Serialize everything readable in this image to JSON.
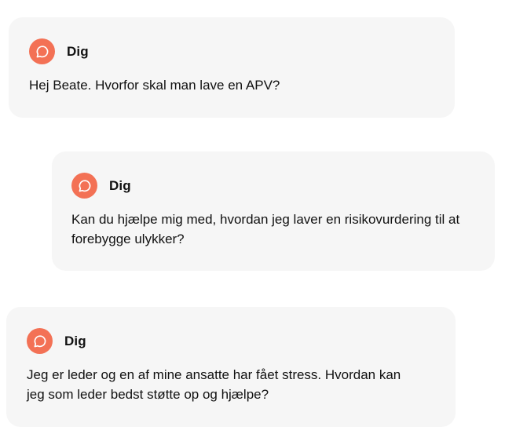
{
  "messages": [
    {
      "sender": "Dig",
      "text": "Hej Beate. Hvorfor skal man lave en APV?",
      "avatar_icon": "chat-bubble-icon"
    },
    {
      "sender": "Dig",
      "text": "Kan du hjælpe mig med, hvordan jeg laver en risikovurdering til at forebygge ulykker?",
      "avatar_icon": "chat-bubble-icon"
    },
    {
      "sender": "Dig",
      "text": "Jeg er leder og en af mine ansatte har fået stress. Hvordan kan jeg som leder bedst støtte op og hjælpe?",
      "avatar_icon": "chat-bubble-icon"
    }
  ],
  "colors": {
    "avatar_bg": "#f37155",
    "card_bg": "#f6f6f6",
    "text": "#111111"
  }
}
